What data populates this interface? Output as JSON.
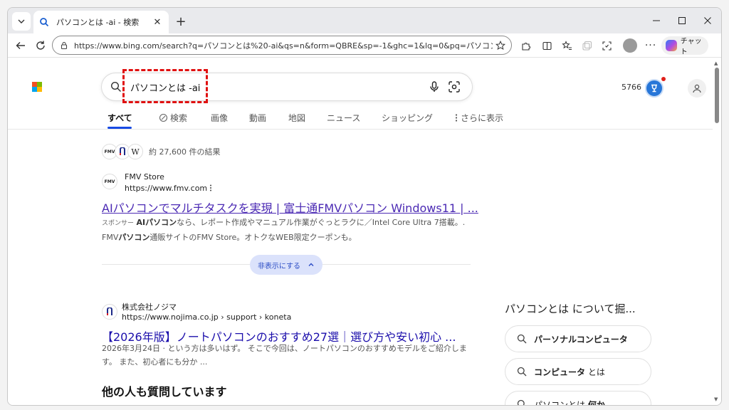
{
  "browser": {
    "tab": {
      "title": "パソコンとは -ai - 検索",
      "close_glyph": "✕"
    },
    "new_tab_glyph": "+",
    "address_bar": {
      "url": "https://www.bing.com/search?q=パソコンとは%20-ai&qs=n&form=QBRE&sp=-1&ghc=1&lq=0&pq=パソコンとは%20-ai..."
    },
    "copilot_label": "チャット",
    "more_glyph": "···"
  },
  "search": {
    "query": "パソコンとは -ai",
    "rewards_points": "5766"
  },
  "scopes": [
    {
      "label": "すべて",
      "active": true
    },
    {
      "label": "検索"
    },
    {
      "label": "画像"
    },
    {
      "label": "動画"
    },
    {
      "label": "地図"
    },
    {
      "label": "ニュース"
    },
    {
      "label": "ショッピング"
    },
    {
      "label": "さらに表示"
    }
  ],
  "sources": {
    "logo_fmv": "FMV",
    "logo_wiki": "W",
    "result_count": "約 27,600 件の結果"
  },
  "ad_result": {
    "favicon_text": "FMV",
    "site_name": "FMV Store",
    "site_url": "https://www.fmv.com",
    "title": "AIパソコンでマルチタスクを実現 | 富士通FMVパソコン Windows11 | ...",
    "sponsor_label": "スポンサー",
    "snippet_line1_pre": "AIパソコン",
    "snippet_line1_post": "なら、レポート作成やマニュアル作業がぐっとラクに／Intel Core Ultra 7搭載。.",
    "snippet_line2_pre": "FMV",
    "snippet_line2_bold": "パソコン",
    "snippet_line2_post": "通販サイトのFMV Store。オトクなWEB限定クーポンも。",
    "collapse_label": "非表示にする"
  },
  "organic_result": {
    "site_name": "株式会社ノジマ",
    "site_url": "https://www.nojima.co.jp › support › koneta",
    "title": "【2026年版】ノートパソコンのおすすめ27選｜選び方や安い初心 ...",
    "snippet_line1": "2026年3月24日 · という方は多いはず。 そこで今回は、ノートパソコンのおすすめモデルをご紹介しま",
    "snippet_line2": "す。 また、初心者にも分か ..."
  },
  "people_also_ask": "他の人も質問しています",
  "related": {
    "heading": "パソコンとは について掘...",
    "items": [
      {
        "bold": "パーソナルコンピュータ",
        "rest": ""
      },
      {
        "bold": "コンピュータ",
        "rest": " とは"
      },
      {
        "bold": "何か",
        "pre": "パソコンとは "
      }
    ]
  },
  "colors": {
    "accent": "#174ae4",
    "link": "#1a0dab",
    "highlight": "#e01010",
    "rewards": "#2776d8"
  }
}
